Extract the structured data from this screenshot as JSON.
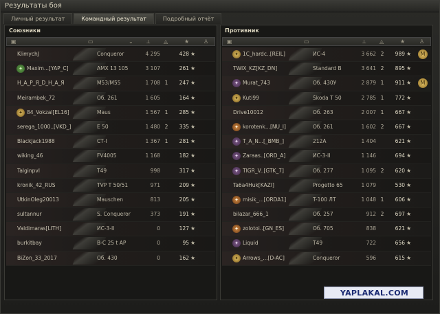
{
  "title": "Результаты боя",
  "tabs": [
    {
      "label": "Личный результат",
      "active": false
    },
    {
      "label": "Командный результат",
      "active": true
    },
    {
      "label": "Подробный отчёт",
      "active": false
    }
  ],
  "left": {
    "title": "Союзники",
    "rows": [
      {
        "player": "KlimychJ",
        "vehicle": "Conqueror",
        "damage": "4 295",
        "kills": "",
        "xp": "428",
        "badge": "",
        "medal": ""
      },
      {
        "player": "Maxim...[YAP_C]",
        "vehicle": "AMX 13 105",
        "damage": "3 107",
        "kills": "",
        "xp": "261",
        "badge": "green",
        "medal": ""
      },
      {
        "player": "H_A_P_Я_D_H_A_Я",
        "vehicle": "M53/M55",
        "damage": "1 708",
        "kills": "1",
        "xp": "247",
        "badge": "",
        "medal": ""
      },
      {
        "player": "Meirambek_72",
        "vehicle": "Об. 261",
        "damage": "1 605",
        "kills": "",
        "xp": "164",
        "badge": "",
        "medal": ""
      },
      {
        "player": "84_Vokzal[EL16]",
        "vehicle": "Maus",
        "damage": "1 567",
        "kills": "1",
        "xp": "285",
        "badge": "gold",
        "medal": ""
      },
      {
        "player": "serega_1000..[VKD_]",
        "vehicle": "E 50",
        "damage": "1 480",
        "kills": "2",
        "xp": "335",
        "badge": "",
        "medal": ""
      },
      {
        "player": "BlackJack1988",
        "vehicle": "СТ-I",
        "damage": "1 367",
        "kills": "1",
        "xp": "281",
        "badge": "",
        "medal": ""
      },
      {
        "player": "wiking_46",
        "vehicle": "FV4005",
        "damage": "1 168",
        "kills": "",
        "xp": "182",
        "badge": "",
        "medal": ""
      },
      {
        "player": "Talginpvl",
        "vehicle": "T49",
        "damage": "998",
        "kills": "",
        "xp": "317",
        "badge": "",
        "medal": ""
      },
      {
        "player": "kronik_42_RUS",
        "vehicle": "TVP T 50/51",
        "damage": "971",
        "kills": "",
        "xp": "209",
        "badge": "",
        "medal": ""
      },
      {
        "player": "UtkinOleg20013",
        "vehicle": "Mauschen",
        "damage": "813",
        "kills": "",
        "xp": "205",
        "badge": "",
        "medal": ""
      },
      {
        "player": "sultannur",
        "vehicle": "S. Conqueror",
        "damage": "373",
        "kills": "",
        "xp": "191",
        "badge": "",
        "medal": ""
      },
      {
        "player": "Valdimaras[LITH]",
        "vehicle": "ИС-3-II",
        "damage": "0",
        "kills": "",
        "xp": "127",
        "badge": "",
        "medal": ""
      },
      {
        "player": "burkitbay",
        "vehicle": "B-C 25 t AP",
        "damage": "0",
        "kills": "",
        "xp": "95",
        "badge": "",
        "medal": ""
      },
      {
        "player": "BiZon_33_2017",
        "vehicle": "Об. 430",
        "damage": "0",
        "kills": "",
        "xp": "162",
        "badge": "",
        "medal": ""
      }
    ]
  },
  "right": {
    "title": "Противник",
    "rows": [
      {
        "player": "1С_hardc..[REIL]",
        "vehicle": "ИС-4",
        "damage": "3 662",
        "kills": "2",
        "xp": "989",
        "badge": "gold",
        "medal": "M"
      },
      {
        "player": "TWIX_KZ[KZ_DN]",
        "vehicle": "Standard B",
        "damage": "3 641",
        "kills": "2",
        "xp": "895",
        "badge": "",
        "medal": ""
      },
      {
        "player": "Murat_743",
        "vehicle": "Об. 430У",
        "damage": "2 879",
        "kills": "1",
        "xp": "911",
        "badge": "purple",
        "medal": "M"
      },
      {
        "player": "Kuti99",
        "vehicle": "Škoda T 50",
        "damage": "2 785",
        "kills": "1",
        "xp": "772",
        "badge": "gold",
        "medal": ""
      },
      {
        "player": "Drive10012",
        "vehicle": "Об. 263",
        "damage": "2 007",
        "kills": "1",
        "xp": "667",
        "badge": "",
        "medal": ""
      },
      {
        "player": "korotenk...[NU_I]",
        "vehicle": "Об. 261",
        "damage": "1 602",
        "kills": "2",
        "xp": "667",
        "badge": "orange",
        "medal": ""
      },
      {
        "player": "T_A_N...[_BMB_]",
        "vehicle": "212A",
        "damage": "1 404",
        "kills": "",
        "xp": "621",
        "badge": "purple",
        "medal": ""
      },
      {
        "player": "Zaraas..[ORD_A]",
        "vehicle": "ИС-3-II",
        "damage": "1 146",
        "kills": "",
        "xp": "694",
        "badge": "purple",
        "medal": ""
      },
      {
        "player": "TIGR_V..[GTK_7]",
        "vehicle": "Об. 277",
        "damage": "1 095",
        "kills": "2",
        "xp": "620",
        "badge": "purple",
        "medal": ""
      },
      {
        "player": "Ta6a4Huk[KAZI]",
        "vehicle": "Progetto 65",
        "damage": "1 079",
        "kills": "",
        "xp": "530",
        "badge": "",
        "medal": ""
      },
      {
        "player": "misik_...[ORDA1]",
        "vehicle": "T-100 ЛТ",
        "damage": "1 048",
        "kills": "1",
        "xp": "606",
        "badge": "orange",
        "medal": ""
      },
      {
        "player": "bilazar_666_1",
        "vehicle": "Об. 257",
        "damage": "912",
        "kills": "2",
        "xp": "697",
        "badge": "",
        "medal": ""
      },
      {
        "player": "zolotoi..[GN_ES]",
        "vehicle": "Об. 705",
        "damage": "838",
        "kills": "",
        "xp": "621",
        "badge": "orange",
        "medal": ""
      },
      {
        "player": "Liquid",
        "vehicle": "T49",
        "damage": "722",
        "kills": "",
        "xp": "656",
        "badge": "purple",
        "medal": ""
      },
      {
        "player": "Arrows_...[D-AC]",
        "vehicle": "Conqueror",
        "damage": "596",
        "kills": "",
        "xp": "615",
        "badge": "gold",
        "medal": ""
      }
    ]
  },
  "star_glyph": "★",
  "watermark": "YAPLAKAL.COM"
}
